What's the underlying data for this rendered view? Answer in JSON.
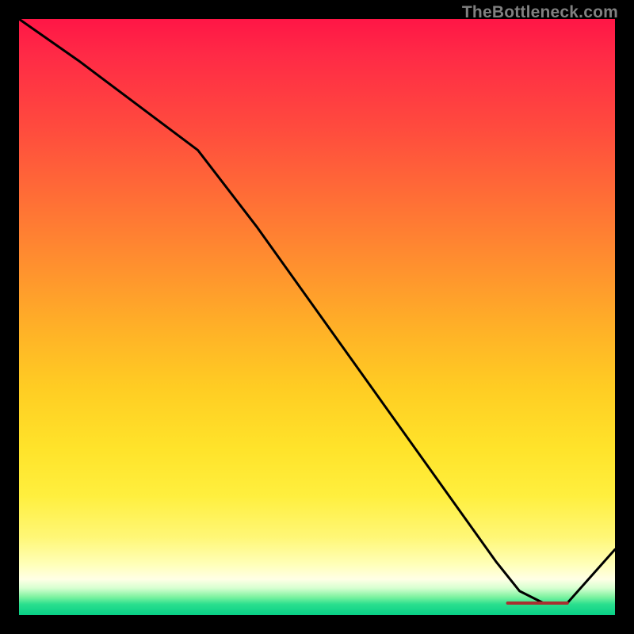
{
  "watermark": "TheBottleneck.com",
  "chart_data": {
    "type": "line",
    "title": "",
    "xlabel": "",
    "ylabel": "",
    "xlim": [
      0,
      100
    ],
    "ylim": [
      0,
      100
    ],
    "x": [
      0,
      10,
      22,
      30,
      40,
      50,
      60,
      70,
      80,
      84,
      88,
      92,
      100
    ],
    "values": [
      100,
      93,
      84,
      78,
      65,
      51,
      37,
      23,
      9,
      4,
      2,
      2,
      11
    ],
    "minimum_band": {
      "x_start": 82,
      "x_end": 92,
      "y": 2
    },
    "gradient_stops": [
      {
        "pct": 0,
        "color": "#ff1646"
      },
      {
        "pct": 50,
        "color": "#ffb127"
      },
      {
        "pct": 80,
        "color": "#ffef3e"
      },
      {
        "pct": 94,
        "color": "#ffffe6"
      },
      {
        "pct": 100,
        "color": "#08cf86"
      }
    ]
  }
}
